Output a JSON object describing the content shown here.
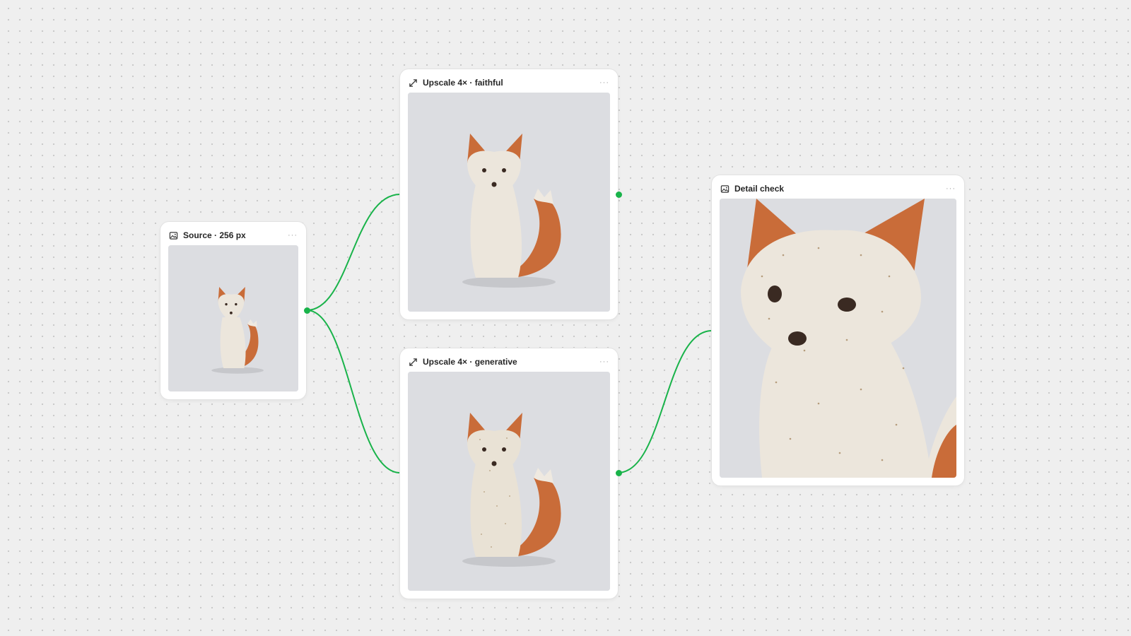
{
  "canvas": {
    "edge_color": "#19b34a",
    "background": "#efefef"
  },
  "nodes": {
    "source": {
      "title": "Source · 256 px",
      "icon": "image-icon",
      "menu": "···"
    },
    "faithful": {
      "title": "Upscale 4× · faithful",
      "icon": "upscale-icon",
      "menu": "···"
    },
    "generative": {
      "title": "Upscale 4× · generative",
      "icon": "upscale-icon",
      "menu": "···"
    },
    "detail": {
      "title": "Detail check",
      "icon": "image-icon",
      "menu": "···"
    }
  }
}
